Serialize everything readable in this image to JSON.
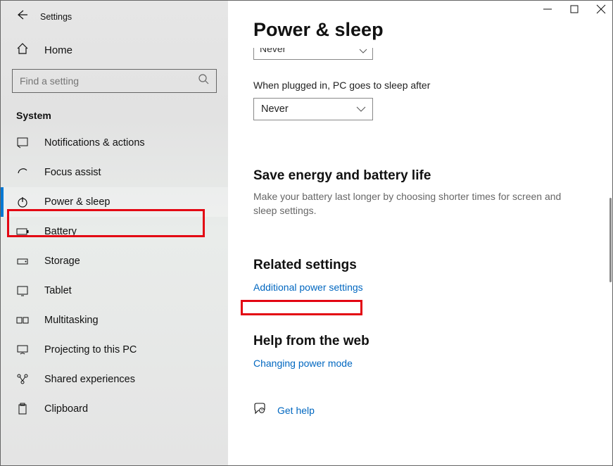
{
  "window": {
    "title": "Settings"
  },
  "sidebar": {
    "home": "Home",
    "search_placeholder": "Find a setting",
    "section": "System",
    "items": [
      {
        "icon": "notifications-icon",
        "label": "Notifications & actions"
      },
      {
        "icon": "focus-assist-icon",
        "label": "Focus assist"
      },
      {
        "icon": "power-icon",
        "label": "Power & sleep",
        "selected": true
      },
      {
        "icon": "battery-icon",
        "label": "Battery"
      },
      {
        "icon": "storage-icon",
        "label": "Storage"
      },
      {
        "icon": "tablet-icon",
        "label": "Tablet"
      },
      {
        "icon": "multitasking-icon",
        "label": "Multitasking"
      },
      {
        "icon": "projecting-icon",
        "label": "Projecting to this PC"
      },
      {
        "icon": "shared-exp-icon",
        "label": "Shared experiences"
      },
      {
        "icon": "clipboard-icon",
        "label": "Clipboard"
      }
    ]
  },
  "main": {
    "title": "Power & sleep",
    "cut_dropdown_value": "Never",
    "field_label": "When plugged in, PC goes to sleep after",
    "dropdown_value": "Never",
    "save_section_title": "Save energy and battery life",
    "save_section_desc": "Make your battery last longer by choosing shorter times for screen and sleep settings.",
    "related_title": "Related settings",
    "related_link": "Additional power settings",
    "help_title": "Help from the web",
    "help_link": "Changing power mode",
    "get_help": "Get help"
  }
}
